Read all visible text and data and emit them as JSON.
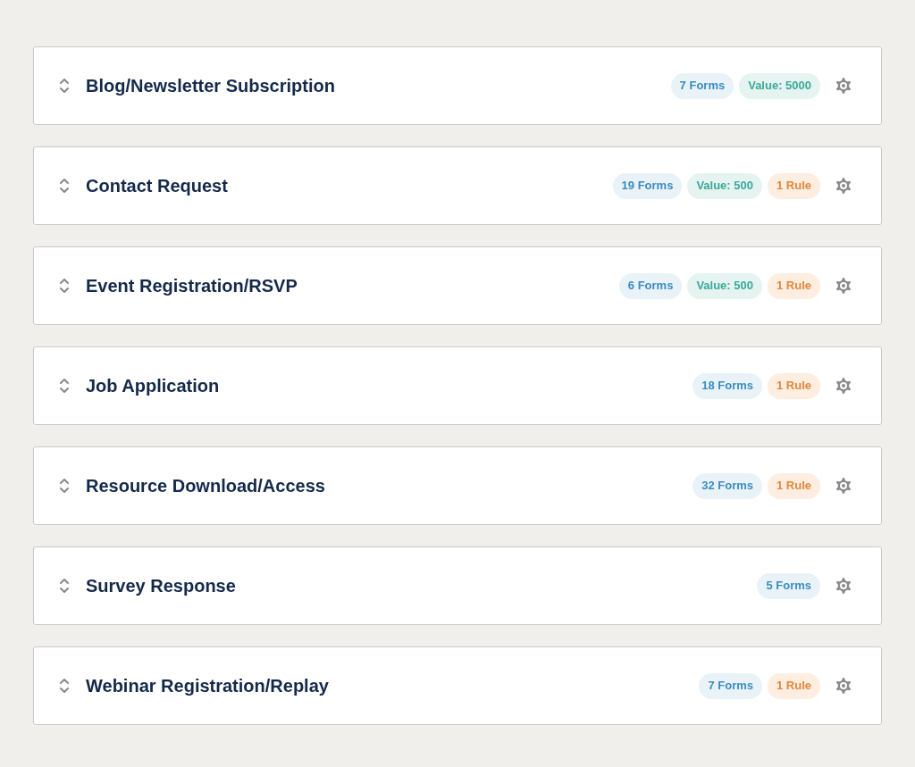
{
  "goals": [
    {
      "title": "Blog/Newsletter Subscription",
      "badges": [
        {
          "kind": "forms",
          "text": "7 Forms"
        },
        {
          "kind": "value",
          "text": "Value: 5000"
        }
      ]
    },
    {
      "title": "Contact Request",
      "badges": [
        {
          "kind": "forms",
          "text": "19 Forms"
        },
        {
          "kind": "value",
          "text": "Value: 500"
        },
        {
          "kind": "rule",
          "text": "1 Rule"
        }
      ]
    },
    {
      "title": "Event Registration/RSVP",
      "badges": [
        {
          "kind": "forms",
          "text": "6 Forms"
        },
        {
          "kind": "value",
          "text": "Value: 500"
        },
        {
          "kind": "rule",
          "text": "1 Rule"
        }
      ]
    },
    {
      "title": "Job Application",
      "badges": [
        {
          "kind": "forms",
          "text": "18 Forms"
        },
        {
          "kind": "rule",
          "text": "1 Rule"
        }
      ]
    },
    {
      "title": "Resource Download/Access",
      "badges": [
        {
          "kind": "forms",
          "text": "32 Forms"
        },
        {
          "kind": "rule",
          "text": "1 Rule"
        }
      ]
    },
    {
      "title": "Survey Response",
      "badges": [
        {
          "kind": "forms",
          "text": "5 Forms"
        }
      ]
    },
    {
      "title": "Webinar Registration/Replay",
      "badges": [
        {
          "kind": "forms",
          "text": "7 Forms"
        },
        {
          "kind": "rule",
          "text": "1 Rule"
        }
      ]
    }
  ]
}
